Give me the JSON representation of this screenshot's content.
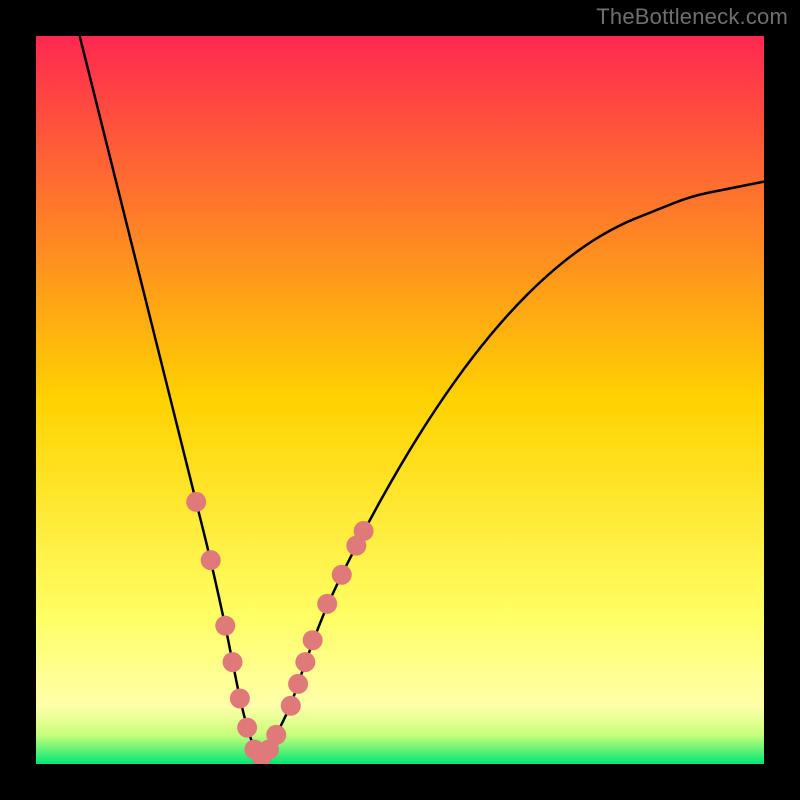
{
  "watermark": "TheBottleneck.com",
  "chart_data": {
    "type": "line",
    "title": "",
    "xlabel": "",
    "ylabel": "",
    "xlim": [
      0,
      100
    ],
    "ylim": [
      0,
      100
    ],
    "background_gradient": {
      "stops": [
        {
          "offset": 0.0,
          "color": "#ff2850"
        },
        {
          "offset": 0.5,
          "color": "#ffd200"
        },
        {
          "offset": 0.8,
          "color": "#ffff66"
        },
        {
          "offset": 0.92,
          "color": "#ffffaa"
        },
        {
          "offset": 0.96,
          "color": "#c8ff7a"
        },
        {
          "offset": 1.0,
          "color": "#00e676"
        }
      ]
    },
    "series": [
      {
        "name": "bottleneck-curve",
        "x": [
          6,
          8,
          10,
          12,
          14,
          16,
          18,
          20,
          22,
          24,
          26,
          27,
          28,
          29,
          30,
          31,
          32,
          33,
          35,
          37,
          40,
          45,
          50,
          55,
          60,
          65,
          70,
          75,
          80,
          85,
          90,
          95,
          100
        ],
        "y": [
          100,
          92,
          84,
          76,
          68,
          60,
          52,
          44,
          36,
          28,
          19,
          14,
          9,
          5,
          2,
          1,
          2,
          4,
          8,
          14,
          22,
          32,
          41,
          49,
          56,
          62,
          67,
          71,
          74,
          76,
          78,
          79,
          80
        ]
      }
    ],
    "markers": {
      "name": "highlighted-points",
      "color": "#e07a7a",
      "radius": 10,
      "points": [
        {
          "x": 22,
          "y": 36
        },
        {
          "x": 24,
          "y": 28
        },
        {
          "x": 26,
          "y": 19
        },
        {
          "x": 27,
          "y": 14
        },
        {
          "x": 28,
          "y": 9
        },
        {
          "x": 29,
          "y": 5
        },
        {
          "x": 30,
          "y": 2
        },
        {
          "x": 31,
          "y": 1
        },
        {
          "x": 32,
          "y": 2
        },
        {
          "x": 33,
          "y": 4
        },
        {
          "x": 35,
          "y": 8
        },
        {
          "x": 36,
          "y": 11
        },
        {
          "x": 37,
          "y": 14
        },
        {
          "x": 38,
          "y": 17
        },
        {
          "x": 40,
          "y": 22
        },
        {
          "x": 42,
          "y": 26
        },
        {
          "x": 44,
          "y": 30
        },
        {
          "x": 45,
          "y": 32
        }
      ]
    }
  }
}
